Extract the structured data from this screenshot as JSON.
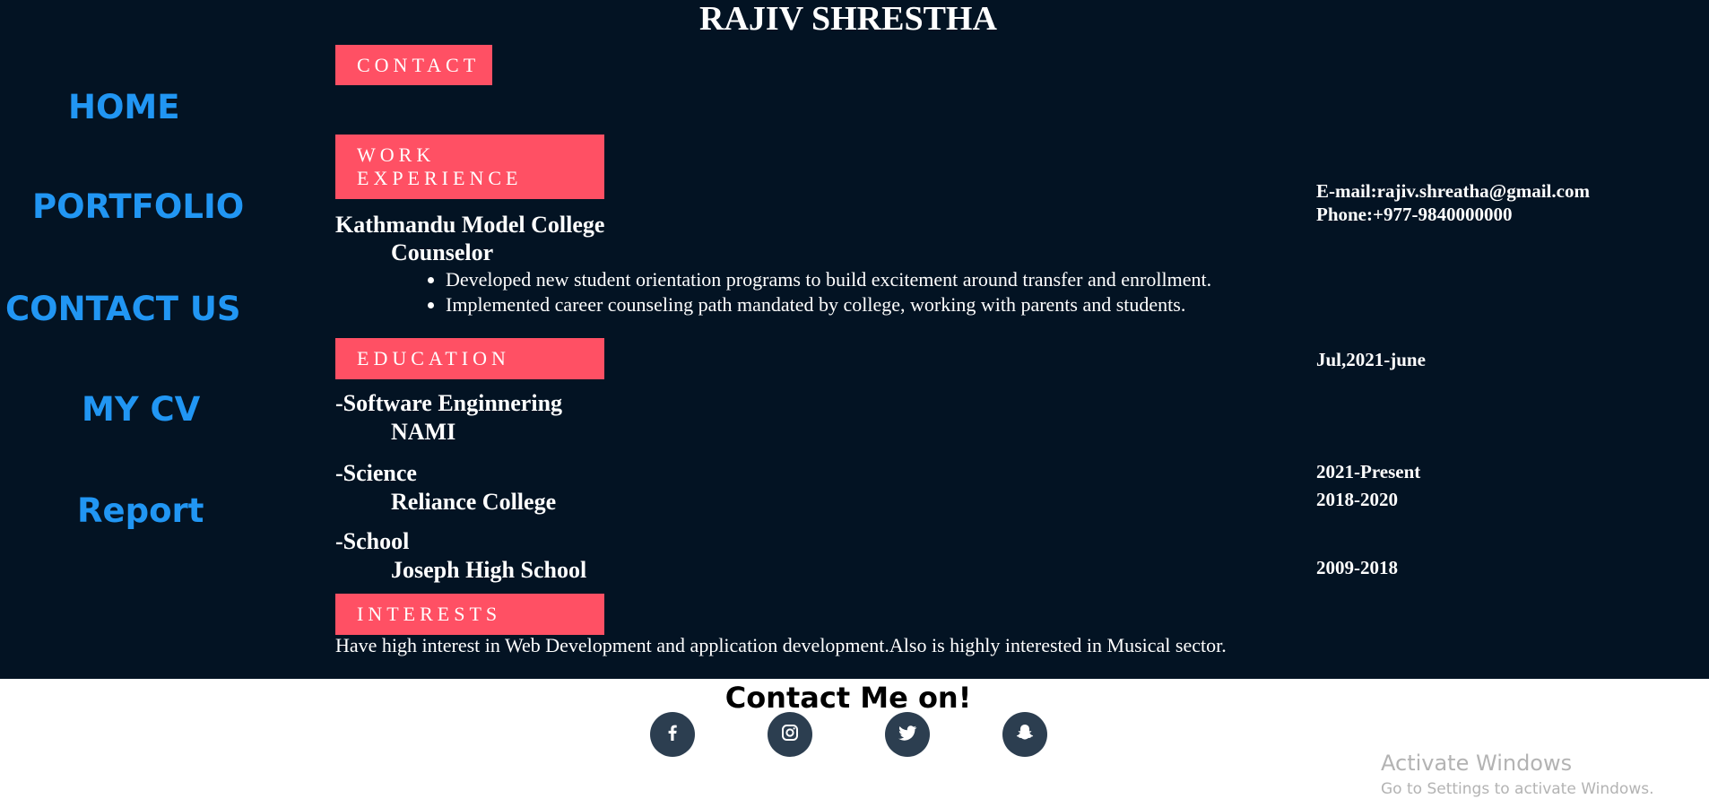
{
  "header": {
    "name": "RAJIV SHRESTHA"
  },
  "nav": {
    "home": "HOME",
    "portfolio": "PORTFOLIO",
    "contact_us": "CONTACT US",
    "my_cv": "MY CV",
    "report": "Report"
  },
  "sections": {
    "contact": "CONTACT",
    "work_line1": "WORK",
    "work_line2": "EXPERIENCE",
    "education": "EDUCATION",
    "interests": "INTERESTS"
  },
  "contact": {
    "email": "E-mail:rajiv.shreatha@gmail.com",
    "phone": "Phone:+977-9840000000"
  },
  "work": {
    "organization": "Kathmandu Model College",
    "role": "Counselor",
    "bullets": [
      "Developed new student orientation programs to build excitement around transfer and enrollment.",
      "Implemented career counseling path mandated by college, working with parents and students."
    ],
    "date": "Jul,2021-june"
  },
  "education": [
    {
      "field": "-Software Enginnering",
      "institution": "NAMI",
      "date": "2021-Present"
    },
    {
      "field": "-Science",
      "institution": "Reliance College",
      "date": "2018-2020"
    },
    {
      "field": "-School",
      "institution": "Joseph High School",
      "date": "2009-2018"
    }
  ],
  "interests": {
    "text": "Have high interest in Web Development and application development.Also is highly interested in Musical sector."
  },
  "footer": {
    "title": "Contact Me on!",
    "socials": [
      {
        "icon": "facebook-icon"
      },
      {
        "icon": "instagram-icon"
      },
      {
        "icon": "twitter-icon"
      },
      {
        "icon": "snapchat-icon"
      }
    ]
  },
  "watermark": {
    "line1": "Activate Windows",
    "line2": "Go to Settings to activate Windows."
  },
  "colors": {
    "background": "#031323",
    "accent": "#ff5064",
    "nav_link": "#2196f3",
    "social_bg": "#2c3e50"
  }
}
